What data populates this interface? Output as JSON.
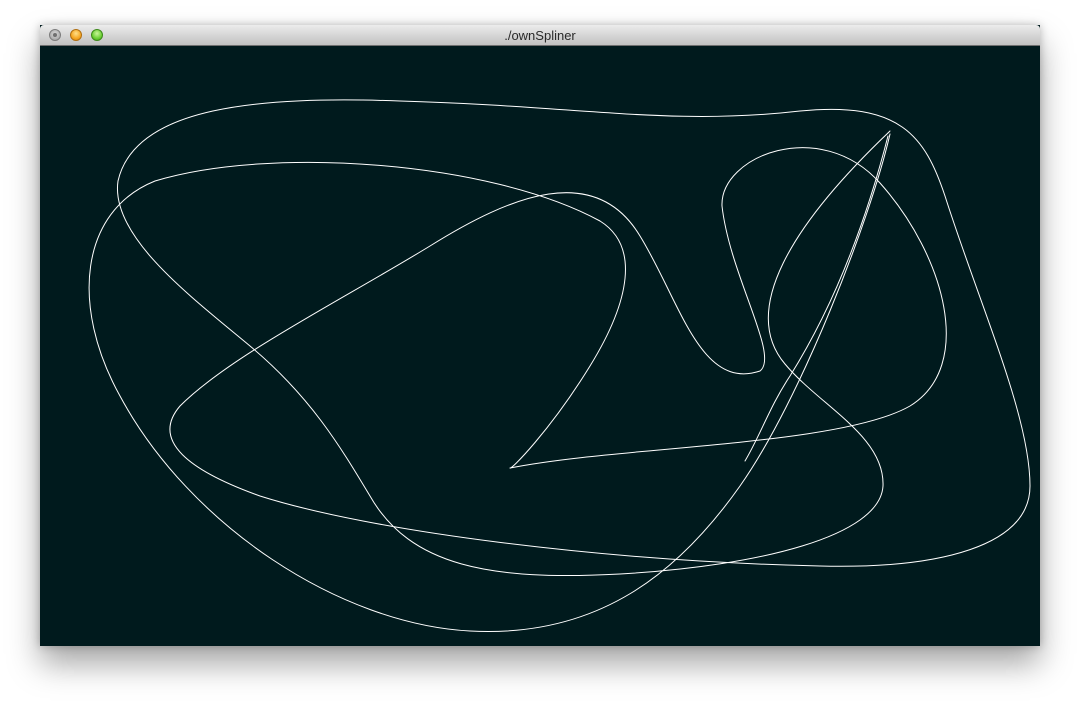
{
  "window": {
    "title": "./ownSpliner"
  },
  "traffic_lights": {
    "close": "close-button",
    "minimize": "minimize-button",
    "zoom": "zoom-button"
  },
  "canvas": {
    "background": "#001a1d",
    "stroke": "#ffffff"
  }
}
